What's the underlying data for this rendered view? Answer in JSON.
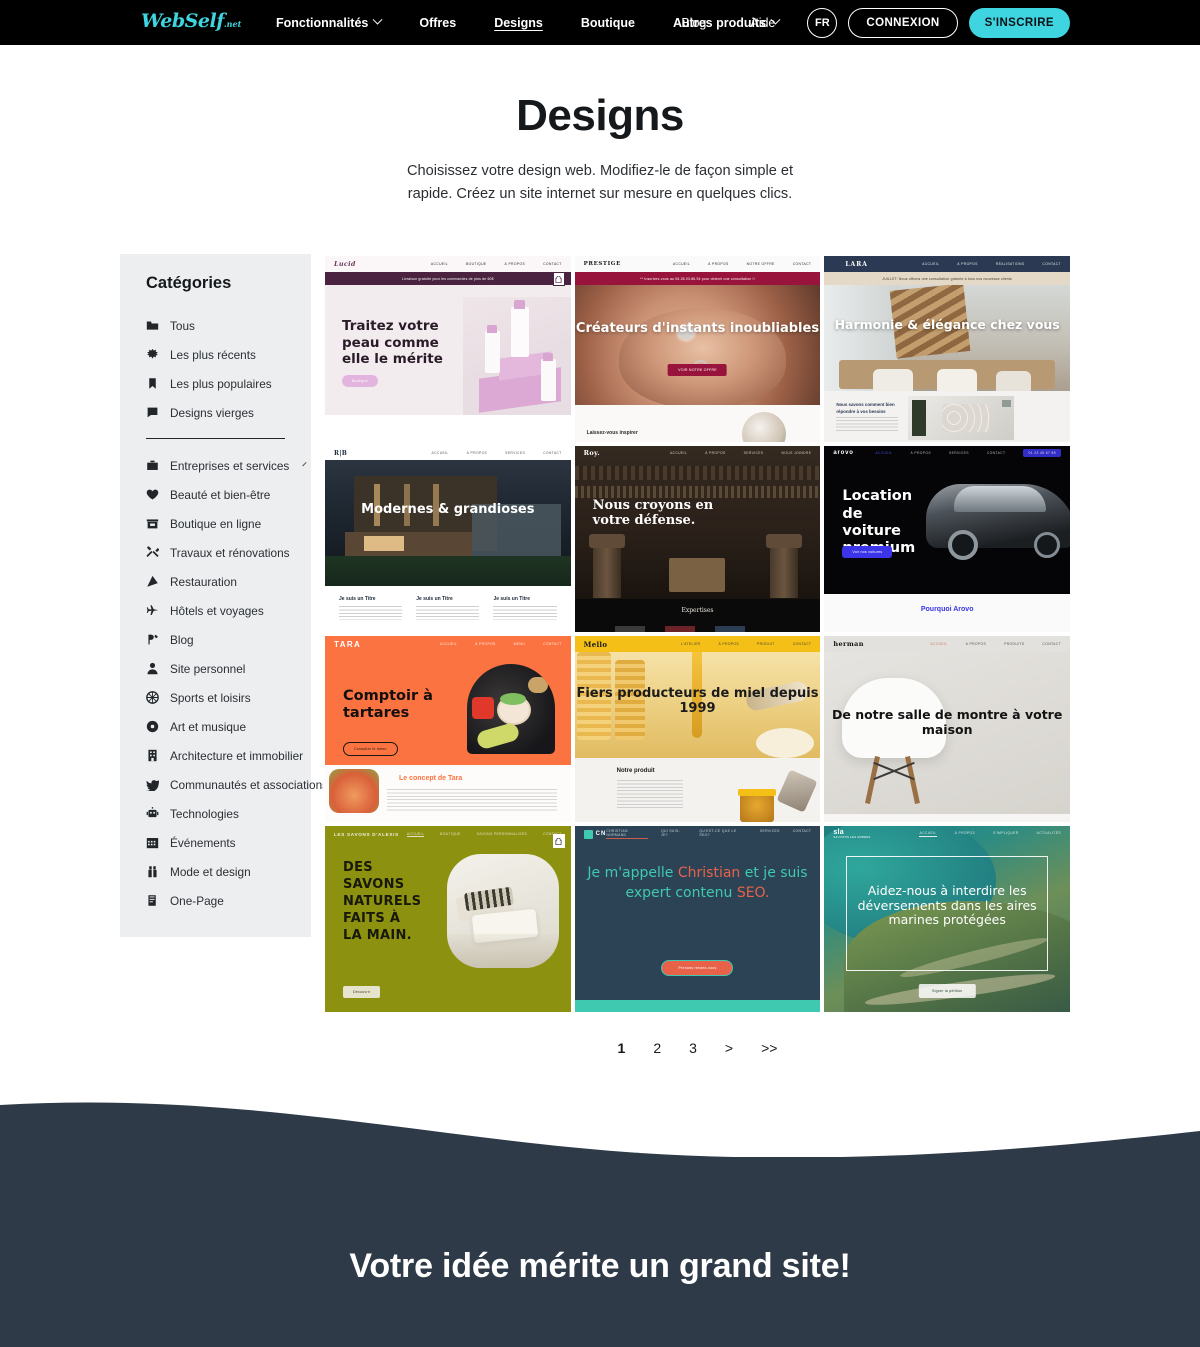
{
  "navbar": {
    "logo": {
      "name": "WebSelf",
      "suffix": ".net"
    },
    "center_links": [
      {
        "label": "Fonctionnalités",
        "has_caret": true,
        "active": false
      },
      {
        "label": "Offres",
        "has_caret": false,
        "active": false
      },
      {
        "label": "Designs",
        "has_caret": false,
        "active": true
      },
      {
        "label": "Boutique",
        "has_caret": false,
        "active": false
      },
      {
        "label": "Autres produits",
        "has_caret": true,
        "active": false
      }
    ],
    "right_links": [
      {
        "label": "Blog"
      },
      {
        "label": "Aide"
      }
    ],
    "lang": "FR",
    "login": "CONNEXION",
    "signup": "S'INSCRIRE",
    "bg": "#000000",
    "accent": "#3fd5e0"
  },
  "hero": {
    "title": "Designs",
    "subtitle": "Choisissez votre design web. Modifiez-le de façon simple et rapide. Créez un site internet sur mesure en quelques clics."
  },
  "sidebar": {
    "title": "Catégories",
    "top_items": [
      {
        "label": "Tous",
        "icon": "folder-icon"
      },
      {
        "label": "Les plus récents",
        "icon": "sparkle-icon"
      },
      {
        "label": "Les plus populaires",
        "icon": "bookmark-icon"
      },
      {
        "label": "Designs vierges",
        "icon": "blank-page-icon"
      }
    ],
    "items": [
      {
        "label": "Entreprises et services",
        "icon": "briefcase-icon",
        "has_caret": true
      },
      {
        "label": "Beauté et bien-être",
        "icon": "heart-icon",
        "has_caret": false
      },
      {
        "label": "Boutique en ligne",
        "icon": "store-icon",
        "has_caret": false
      },
      {
        "label": "Travaux et rénovations",
        "icon": "tools-icon",
        "has_caret": false
      },
      {
        "label": "Restauration",
        "icon": "pizza-icon",
        "has_caret": false
      },
      {
        "label": "Hôtels et voyages",
        "icon": "plane-icon",
        "has_caret": false
      },
      {
        "label": "Blog",
        "icon": "pen-icon",
        "has_caret": false
      },
      {
        "label": "Site personnel",
        "icon": "person-icon",
        "has_caret": false
      },
      {
        "label": "Sports et loisirs",
        "icon": "ball-icon",
        "has_caret": false
      },
      {
        "label": "Art et musique",
        "icon": "disc-icon",
        "has_caret": false
      },
      {
        "label": "Architecture et immobilier",
        "icon": "building-icon",
        "has_caret": false
      },
      {
        "label": "Communautés et associations",
        "icon": "dove-icon",
        "has_caret": false
      },
      {
        "label": "Technologies",
        "icon": "robot-icon",
        "has_caret": false
      },
      {
        "label": "Événements",
        "icon": "calendar-icon",
        "has_caret": false
      },
      {
        "label": "Mode et design",
        "icon": "hanger-icon",
        "has_caret": false
      },
      {
        "label": "One-Page",
        "icon": "onepage-icon",
        "has_caret": false
      }
    ]
  },
  "templates": [
    {
      "name": "Lucid",
      "logo": "Lucid",
      "nav": [
        "ACCUEIL",
        "BOUTIQUE",
        "À PROPOS",
        "CONTACT"
      ],
      "banner": "Livraison gratuite pour les commandes de plus de 60$",
      "headline": "Traitez votre peau comme elle le mérite",
      "button": "Boutique",
      "has_cart": true
    },
    {
      "name": "Prestige",
      "logo": "PRESTIGE",
      "nav": [
        "ACCUEIL",
        "À PROPOS",
        "NOTRE OFFRE",
        "CONTACT"
      ],
      "banner": "** Inscrivez-vous au 06.28.03.86.94 pour obtenir une consultation !!",
      "headline": "Créateurs d'instants inoubliables",
      "button": "VOIR NOTRE OFFRE",
      "footer_text": "Laissez-vous inspirer",
      "has_cart": false
    },
    {
      "name": "Lara",
      "logo": "LARA",
      "nav": [
        "Accueil",
        "À propos",
        "Réalisations",
        "Contact"
      ],
      "banner": "JUILLET: Nous offrons une consultation gratuite à tous nos nouveaux clients",
      "headline": "Harmonie & élégance chez vous",
      "footer_text": "Nous savons comment bien répondre à vos besoins",
      "has_cart": false
    },
    {
      "name": "RB",
      "logo": "R|B",
      "nav": [
        "Accueil",
        "À Propos",
        "Services",
        "Contact"
      ],
      "headline": "Modernes & grandioses",
      "columns": [
        "Je suis un Titre",
        "Je suis un Titre",
        "Je suis un Titre"
      ],
      "has_cart": false
    },
    {
      "name": "Roy",
      "logo": "Roy.",
      "nav": [
        "ACCUEIL",
        "À PROPOS",
        "SERVICES",
        "NOUS JOINDRE"
      ],
      "headline": "Nous croyons en votre défense.",
      "footer_text": "Expertises",
      "has_cart": false
    },
    {
      "name": "Arovo",
      "logo": "arovo",
      "nav": [
        "Accueil",
        "À propos",
        "Services",
        "Contact"
      ],
      "badge": "01 23 45 67 89",
      "headline": "Location de voiture premium",
      "button": "Voir nos voitures",
      "footer_text": "Pourquoi Arovo",
      "has_cart": false
    },
    {
      "name": "Tara",
      "logo": "TARA",
      "nav": [
        "Accueil",
        "À propos",
        "Menu",
        "Contact"
      ],
      "headline": "Comptoir à tartares",
      "button": "Consulter le menu",
      "footer_text": "Le concept de Tara",
      "has_cart": false
    },
    {
      "name": "Mello",
      "logo": "Mello",
      "nav": [
        "L'ATELIER",
        "À PROPOS",
        "PRODUIT",
        "CONTACT"
      ],
      "headline": "Fiers producteurs de miel depuis 1999",
      "footer_text": "Notre produit",
      "has_cart": false
    },
    {
      "name": "Herman",
      "logo": "herman",
      "nav": [
        "Accueil",
        "À propos",
        "Produits",
        "Contact"
      ],
      "headline": "De notre salle de montre à votre maison",
      "has_cart": false
    },
    {
      "name": "Les Savons d'Alexis",
      "logo": "LES SAVONS D'ALEXIS",
      "nav": [
        "Accueil",
        "Boutique",
        "Savons personnalisés",
        "Contact"
      ],
      "headline": "DES SAVONS NATURELS FAITS À LA MAIN.",
      "button": "Découvrir",
      "has_cart": true
    },
    {
      "name": "Christian Normand",
      "logo": "CN",
      "nav": [
        "Christian Normand",
        "Qui suis-je?",
        "Qu'est-ce que le SEO?",
        "Services",
        "Contact"
      ],
      "headline_parts": [
        "Je m'appelle ",
        "Christian",
        " et je suis expert contenu ",
        "SEO."
      ],
      "button": "Prenons rendez-vous",
      "has_cart": false
    },
    {
      "name": "SLA",
      "logo": "sla",
      "logo_sub": "SAUVONS LES ARBRES",
      "nav": [
        "Accueil",
        "À propos",
        "S'impliquer",
        "Actualités"
      ],
      "headline": "Aidez-nous à interdire les déversements dans les aires marines protégées",
      "button": "Signer la pétition",
      "has_cart": false
    }
  ],
  "pagination": {
    "pages": [
      "1",
      "2",
      "3"
    ],
    "current": "1",
    "next": ">",
    "last": ">>"
  },
  "footer": {
    "title": "Votre idée mérite un grand site!",
    "bg": "#2e3a47"
  }
}
